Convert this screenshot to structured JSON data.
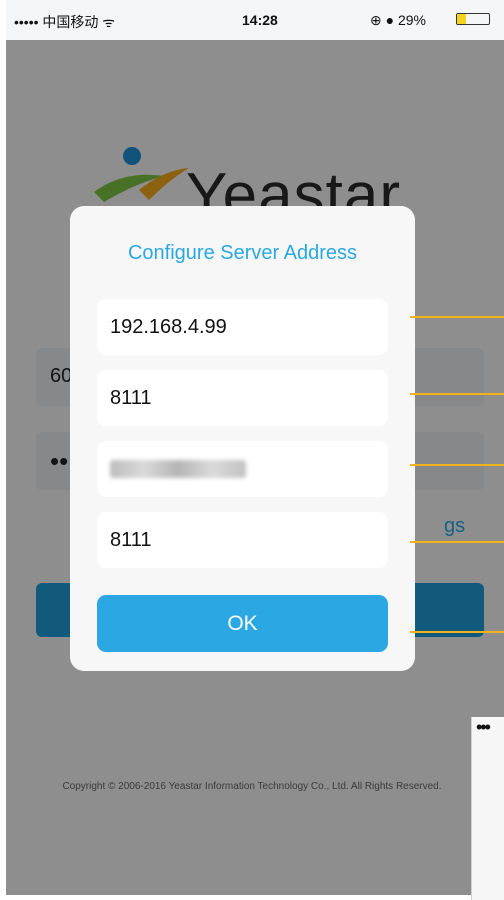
{
  "status_bar": {
    "carrier": "••••• 中国移动 ᯤ",
    "time": "14:28",
    "right": "⊕ ● 29%",
    "battery_level": 0.29
  },
  "background": {
    "logo_text": "Yeastar",
    "extension_value": "60",
    "password_value": "••",
    "settings_link": "gs",
    "copyright": "Copyright © 2006-2016 Yeastar Information Technology Co., Ltd. All Rights Reserved."
  },
  "dialog": {
    "title": "Configure Server Address",
    "fields": [
      {
        "value": "192.168.4.99"
      },
      {
        "value": "8111"
      },
      {
        "value": ""
      },
      {
        "value": "8111"
      }
    ],
    "ok_label": "OK"
  },
  "second_screenshot": {
    "status_dots": "•••"
  },
  "colors": {
    "accent": "#2aa8e0",
    "callout": "#f3b21c"
  }
}
